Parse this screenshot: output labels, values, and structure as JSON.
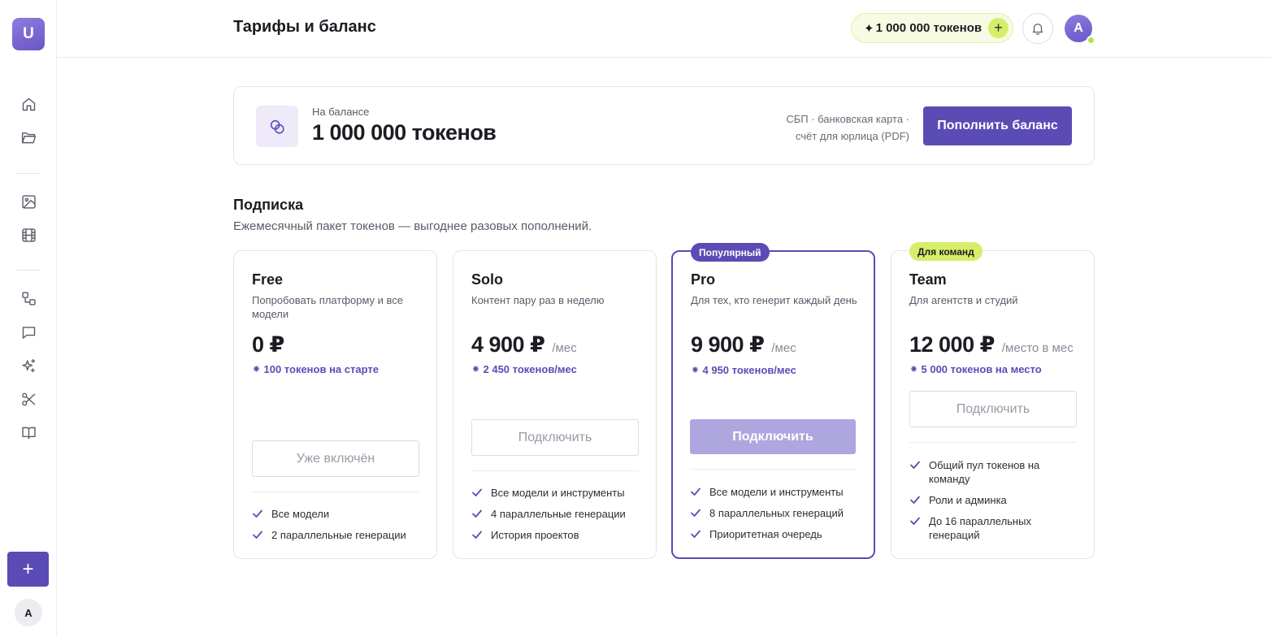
{
  "sidebar": {
    "logo_letter": "U",
    "items": [
      {
        "name": "home-icon"
      },
      {
        "name": "folder-icon"
      },
      {
        "name": "image-icon"
      },
      {
        "name": "film-icon"
      },
      {
        "name": "workflow-icon"
      },
      {
        "name": "chat-icon"
      },
      {
        "name": "sparkles-icon"
      },
      {
        "name": "scissors-icon"
      },
      {
        "name": "book-icon"
      }
    ],
    "add_label": "+",
    "avatar_letter": "A"
  },
  "header": {
    "title": "Тарифы и баланс",
    "tokens": "1 000 000 токенов",
    "token_spark": "✦",
    "token_plus": "+",
    "avatar_letter": "A"
  },
  "balance": {
    "label": "На балансе",
    "value": "1 000 000 токенов",
    "methods_line1": "СБП · банковская карта ·",
    "methods_line2": "счёт для юрлица (PDF)",
    "topup_label": "Пополнить баланс"
  },
  "subscription": {
    "title": "Подписка",
    "description": "Ежемесячный пакет токенов — выгоднее разовых пополнений."
  },
  "plans": [
    {
      "name": "Free",
      "tagline": "Попробовать платформу и все модели",
      "price": "0 ₽",
      "per": "",
      "tokens": "⁕ 100 токенов на старте",
      "button": "Уже включён",
      "features": [
        "Все модели",
        "2 параллельные генерации"
      ]
    },
    {
      "name": "Solo",
      "tagline": "Контент пару раз в неделю",
      "price": "4 900 ₽",
      "per": "/мес",
      "tokens": "⁕ 2 450 токенов/мес",
      "button": "Подключить",
      "features": [
        "Все модели и инструменты",
        "4 параллельные генерации",
        "История проектов"
      ]
    },
    {
      "name": "Pro",
      "badge": "Популярный",
      "tagline": "Для тех, кто генерит каждый день",
      "price": "9 900 ₽",
      "per": "/мес",
      "tokens": "⁕ 4 950 токенов/мес",
      "button": "Подключить",
      "features": [
        "Все модели и инструменты",
        "8 параллельных генераций",
        "Приоритетная очередь"
      ]
    },
    {
      "name": "Team",
      "badge": "Для команд",
      "tagline": "Для агентств и студий",
      "price": "12 000 ₽",
      "per": "/место в мес",
      "tokens": "⁕ 5 000 токенов на место",
      "button": "Подключить",
      "features": [
        "Общий пул токенов на команду",
        "Роли и админка",
        "До 16 параллельных генераций"
      ]
    }
  ]
}
